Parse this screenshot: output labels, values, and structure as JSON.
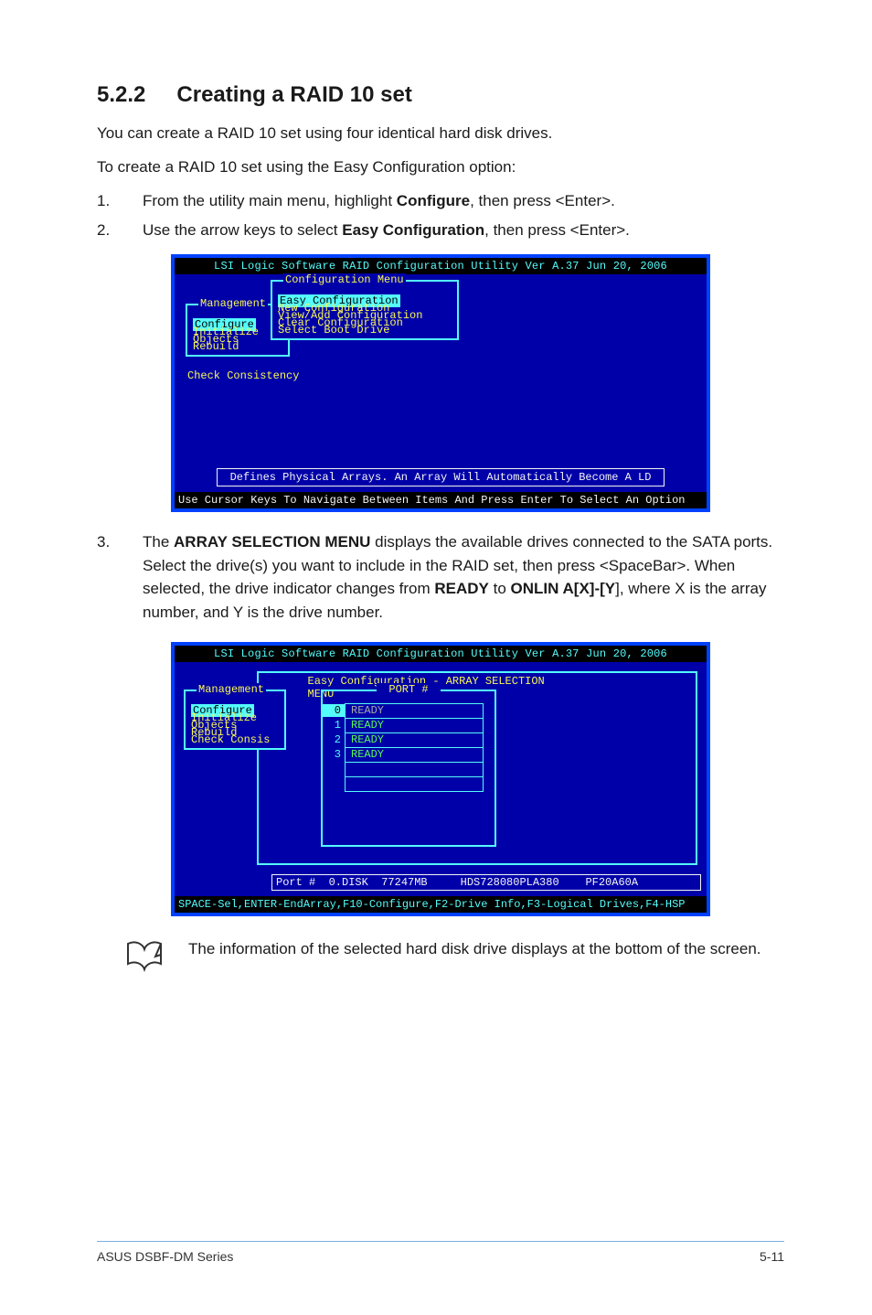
{
  "section": {
    "number": "5.2.2",
    "title": "Creating a RAID 10 set"
  },
  "intro1": "You can create a RAID 10 set using four identical hard disk drives.",
  "intro2": "To create a RAID 10 set using the Easy Configuration option:",
  "step1": {
    "pre": "From the utility main menu, highlight ",
    "bold": "Configure",
    "post": ", then press <Enter>."
  },
  "step2": {
    "pre": "Use the arrow keys to select ",
    "bold": "Easy Configuration",
    "post": ", then press <Enter>."
  },
  "terminal1": {
    "title": "LSI Logic Software RAID Configuration Utility Ver A.37 Jun 20, 2006",
    "config_menu": {
      "title": "Configuration Menu",
      "items": [
        "Easy Configuration",
        "New Configuration",
        "View/Add Configuration",
        "Clear Configuration",
        "Select Boot Drive"
      ]
    },
    "mgmt_menu": {
      "title": "Management",
      "items": [
        "Configure",
        "Initialize",
        "Objects",
        "Rebuild"
      ]
    },
    "check_consistency": "Check Consistency",
    "defines": "Defines Physical Arrays. An Array Will Automatically Become A LD",
    "footer": "Use Cursor Keys To Navigate Between Items And Press Enter To Select An Option"
  },
  "step3": {
    "pre": "The ",
    "bold1": "ARRAY SELECTION MENU",
    "mid1": " displays the available drives connected to the SATA ports. Select the drive(s) you want to include in the RAID set, then press <SpaceBar>. When selected, the drive indicator changes from ",
    "bold2": "READY",
    "mid2": " to ",
    "bold3": "ONLIN A[X]-[Y",
    "post": "], where X is the array number, and Y is the drive number."
  },
  "terminal2": {
    "title": "LSI Logic Software RAID Configuration Utility Ver A.37 Jun 20, 2006",
    "easy_title": "Easy Configuration - ARRAY SELECTION MENU",
    "port_header": "PORT #",
    "ports": [
      {
        "idx": "0",
        "label": "READY",
        "selected": true
      },
      {
        "idx": "1",
        "label": "READY",
        "selected": false
      },
      {
        "idx": "2",
        "label": "READY",
        "selected": false
      },
      {
        "idx": "3",
        "label": "READY",
        "selected": false
      }
    ],
    "mgmt_menu": {
      "title": "Management",
      "items": [
        "Configure",
        "Initialize",
        "Objects",
        "Rebuild",
        "Check Consis"
      ]
    },
    "driveinfo": "Port #  0.DISK  77247MB     HDS728080PLA380    PF20A60A",
    "footer": "SPACE-Sel,ENTER-EndArray,F10-Configure,F2-Drive Info,F3-Logical Drives,F4-HSP"
  },
  "note": "The information of the selected hard disk drive displays at the bottom of the screen.",
  "footer": {
    "left": "ASUS DSBF-DM Series",
    "right": "5-11"
  }
}
